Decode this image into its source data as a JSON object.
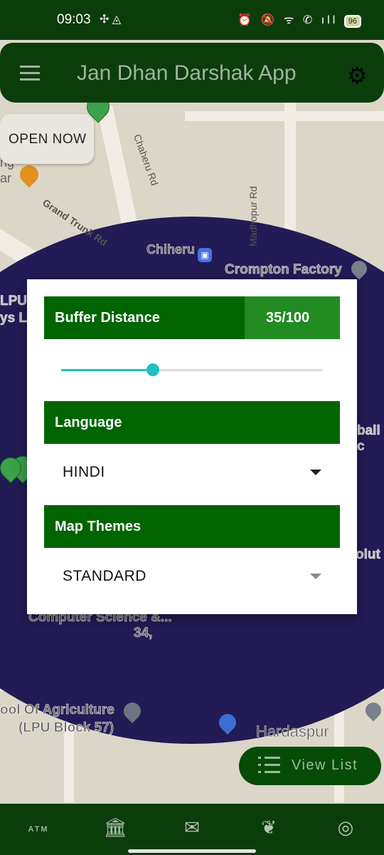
{
  "status_bar": {
    "time": "09:03",
    "left_icons": "✣ ◬",
    "right_icons": "⏰ 🔕 ᯤ ✆ ıll",
    "battery": "96"
  },
  "app_bar": {
    "title": "Jan Dhan Darshak App",
    "menu_icon": "hamburger-menu-icon",
    "settings_icon": "gear-icon"
  },
  "map": {
    "open_now_label": "OPEN NOW",
    "labels": {
      "chaheru_rd": "Chaheru Rd",
      "grand_trunk_rd": "Grand Trunk Rd",
      "madhopur_rd": "Madhopur Rd",
      "chiheru": "Chiheru",
      "crompton_factory": "Crompton Factory",
      "lpu": "LPU",
      "lpu_partial": "ys La",
      "ball_partial": "ball c",
      "olut_partial": "olut",
      "computer_science": "Computer Science &...",
      "number_34": "34,",
      "agriculture": "ool Of Agriculture",
      "lpu_block": "(LPU Block 57)",
      "hardaspur": "Hardaspur",
      "ng": "ng",
      "ar": "ar"
    }
  },
  "dialog": {
    "buffer": {
      "label": "Buffer Distance",
      "value_text": "35/100",
      "value": 35,
      "max": 100
    },
    "language": {
      "label": "Language",
      "selected": "HINDI"
    },
    "map_themes": {
      "label": "Map Themes",
      "selected": "STANDARD"
    }
  },
  "view_list": {
    "label": "View List",
    "icon": "list-icon"
  },
  "bottom_nav": {
    "atm_label": "ATM",
    "items": [
      "bank-icon",
      "mail-icon",
      "leaf-icon",
      "globe-icon"
    ]
  },
  "colors": {
    "primary": "#006400",
    "accent": "#228b22",
    "dark": "#0b3d0b",
    "slider": "#1fc1c1",
    "buffer_circle": "#221b55"
  }
}
